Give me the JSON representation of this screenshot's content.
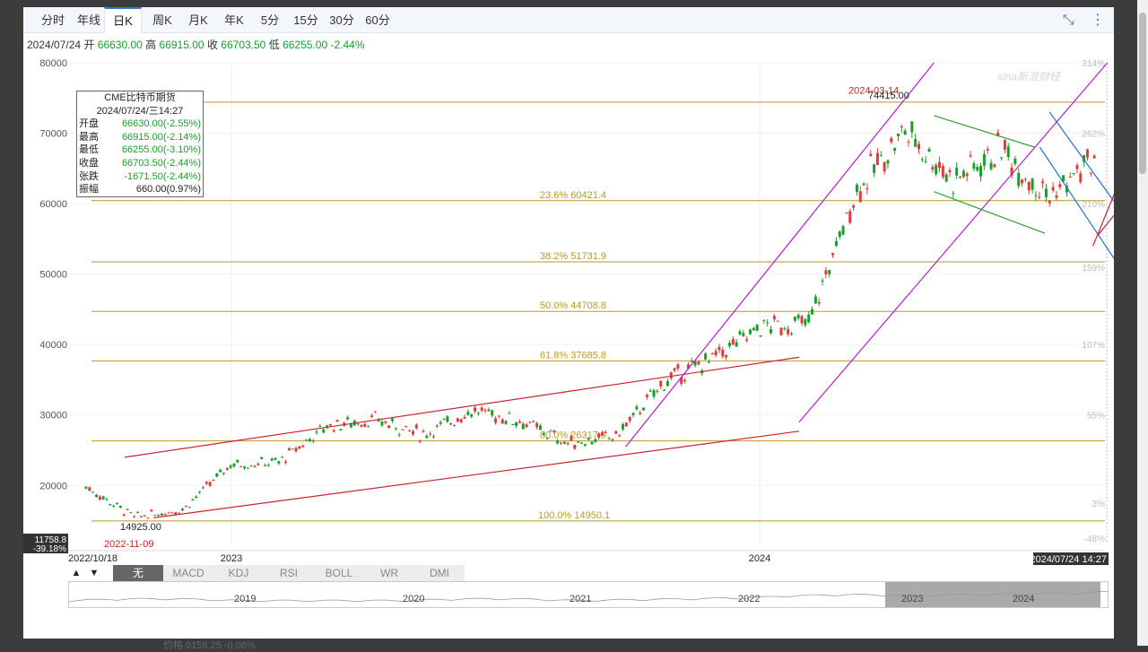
{
  "tabs": [
    "分时",
    "年线",
    "日K",
    "周K",
    "月K",
    "年K",
    "5分",
    "15分",
    "30分",
    "60分"
  ],
  "active_tab": "日K",
  "ohlc_bar": {
    "date": "2024/07/24",
    "open_label": "开",
    "open": "66630.00",
    "high_label": "高",
    "high": "66915.00",
    "close_label": "收",
    "close": "66703.50",
    "low_label": "低",
    "low": "66255.00",
    "change": "-2.44%"
  },
  "info_box": {
    "title": "CME比特币期货",
    "datetime": "2024/07/24/三14:27",
    "rows": [
      {
        "label": "开盘",
        "value": "66630.00(-2.55%)"
      },
      {
        "label": "最高",
        "value": "66915.00(-2.14%)"
      },
      {
        "label": "最低",
        "value": "66255.00(-3.10%)"
      },
      {
        "label": "收盘",
        "value": "66703.50(-2.44%)"
      },
      {
        "label": "张跌",
        "value": "-1671.50(-2.44%)"
      },
      {
        "label": "振幅",
        "value": "660.00(0.97%)"
      }
    ]
  },
  "indicator_tabs": [
    "无",
    "MACD",
    "KDJ",
    "RSI",
    "BOLL",
    "WR",
    "DMI"
  ],
  "navigator_years": [
    "2019",
    "2020",
    "2021",
    "2022",
    "2023",
    "2024"
  ],
  "watermark": "sina新浪财经",
  "bottom_partial_text": "价格    9158.25   -0.08%",
  "colors": {
    "up": "#e03b3b",
    "down": "#1a9e2b",
    "fib": "#b89a2a",
    "channel_red": "#cc2233",
    "channel_purple": "#b020d0",
    "channel_blue": "#2a6fd6",
    "channel_green": "#2aa02a"
  },
  "chart_data": {
    "type": "candlestick",
    "ylim": [
      11758.8,
      80000
    ],
    "y_ticks": [
      20000,
      30000,
      40000,
      50000,
      60000,
      70000,
      80000
    ],
    "right_pct_ticks": [
      "314%",
      "262%",
      "210%",
      "159%",
      "107%",
      "55%",
      "3%",
      "-48%"
    ],
    "x_labels": [
      "2022/10/18",
      "2023",
      "2024",
      "2024/07/24 14:27"
    ],
    "cursor_price": "11758.8",
    "cursor_pct": "-39.18%",
    "annotations": [
      {
        "text": "2024-03-14",
        "value": 74415.0,
        "label": "74415.00"
      },
      {
        "text": "2022-11-09",
        "value": 14925.0,
        "label": "14925.00"
      }
    ],
    "fib_levels": [
      {
        "label": "23.6% 60421.4",
        "value": 60421.4
      },
      {
        "label": "38.2% 51731.9",
        "value": 51731.9
      },
      {
        "label": "50.0% 44708.8",
        "value": 44708.8
      },
      {
        "label": "61.8% 37685.8",
        "value": 37685.8
      },
      {
        "label": "80.0% 26317.9",
        "value": 26317.9
      },
      {
        "label": "100.0% 14950.1",
        "value": 14950.1
      },
      {
        "label": "",
        "value": 74415.0
      }
    ],
    "series": [
      {
        "date": "2022-10",
        "close": 19800
      },
      {
        "date": "2022-11",
        "close": 15500
      },
      {
        "date": "2022-12",
        "close": 16600
      },
      {
        "date": "2023-01",
        "close": 23000
      },
      {
        "date": "2023-02",
        "close": 23300
      },
      {
        "date": "2023-03",
        "close": 28500
      },
      {
        "date": "2023-04",
        "close": 29300
      },
      {
        "date": "2023-05",
        "close": 27200
      },
      {
        "date": "2023-06",
        "close": 30600
      },
      {
        "date": "2023-07",
        "close": 29200
      },
      {
        "date": "2023-08",
        "close": 26000
      },
      {
        "date": "2023-09",
        "close": 27000
      },
      {
        "date": "2023-10",
        "close": 34700
      },
      {
        "date": "2023-11",
        "close": 38000
      },
      {
        "date": "2023-12",
        "close": 42500
      },
      {
        "date": "2024-01",
        "close": 43000
      },
      {
        "date": "2024-02",
        "close": 62000
      },
      {
        "date": "2024-03",
        "close": 70500
      },
      {
        "date": "2024-04",
        "close": 63500
      },
      {
        "date": "2024-05",
        "close": 67800
      },
      {
        "date": "2024-06",
        "close": 61000
      },
      {
        "date": "2024-07",
        "close": 66703.5
      }
    ]
  }
}
